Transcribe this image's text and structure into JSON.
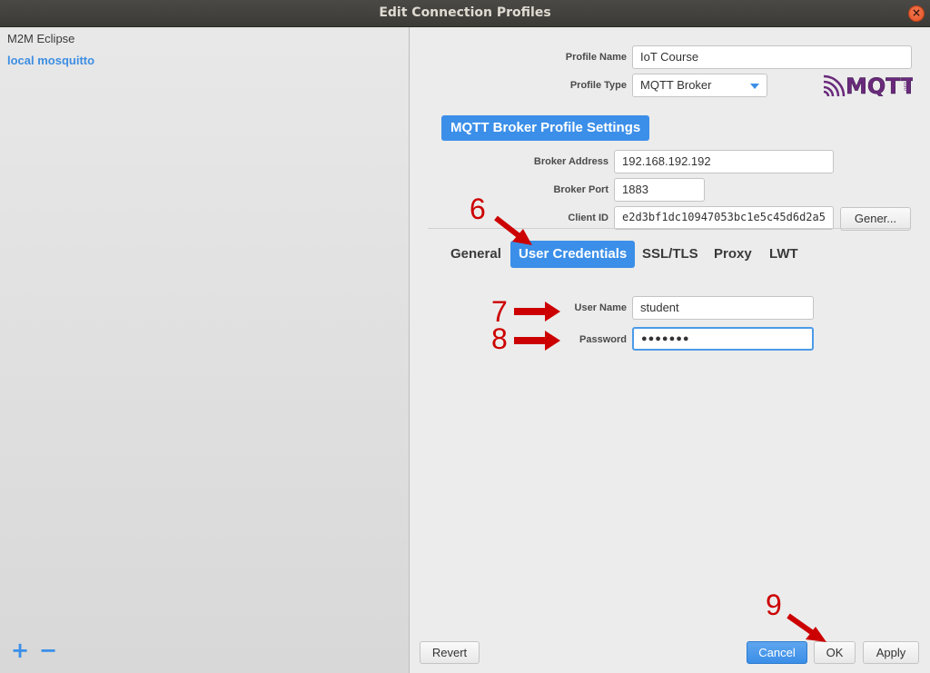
{
  "window": {
    "title": "Edit Connection Profiles"
  },
  "profiles": [
    {
      "label": "M2M Eclipse",
      "selected": false
    },
    {
      "label": "local mosquitto",
      "selected": true
    }
  ],
  "list_controls": {
    "add": "+",
    "remove": "−"
  },
  "profile": {
    "name_label": "Profile Name",
    "name_value": "IoT Course",
    "type_label": "Profile Type",
    "type_value": "MQTT Broker",
    "logo_text": "MQTT",
    "logo_suffix": ".org"
  },
  "broker": {
    "section_label": "MQTT Broker Profile Settings",
    "address_label": "Broker Address",
    "address_value": "192.168.192.192",
    "port_label": "Broker Port",
    "port_value": "1883",
    "client_id_label": "Client ID",
    "client_id_value": "e2d3bf1dc10947053bc1e5c45d6d2a5",
    "generate_label": "Gener..."
  },
  "tabs": [
    {
      "label": "General",
      "active": false
    },
    {
      "label": "User Credentials",
      "active": true
    },
    {
      "label": "SSL/TLS",
      "active": false
    },
    {
      "label": "Proxy",
      "active": false
    },
    {
      "label": "LWT",
      "active": false
    }
  ],
  "credentials": {
    "username_label": "User Name",
    "username_value": "student",
    "password_label": "Password",
    "password_value": "●●●●●●●"
  },
  "buttons": {
    "revert": "Revert",
    "cancel": "Cancel",
    "ok": "OK",
    "apply": "Apply"
  },
  "annotations": [
    "6",
    "7",
    "8",
    "9"
  ],
  "colors": {
    "accent": "#3b8fe8",
    "annotation": "#cc0000",
    "titlebar": "#3c3b37"
  }
}
